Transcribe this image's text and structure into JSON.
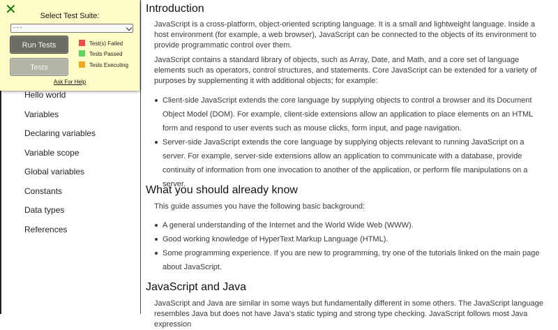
{
  "test_panel": {
    "title": "Select Test Suite:",
    "select_value": "- - -",
    "run_button": "Run Tests",
    "tests_button": "Tests",
    "legend": [
      {
        "label": "Test(s) Failed",
        "color": "#f04b4b"
      },
      {
        "label": "Tests Passed",
        "color": "#5cd65c"
      },
      {
        "label": "Tests Executing",
        "color": "#f5a623"
      }
    ],
    "help_link": "Ask For Help"
  },
  "sidebar": {
    "items": [
      {
        "label": "Hello world"
      },
      {
        "label": "Variables"
      },
      {
        "label": "Declaring variables"
      },
      {
        "label": "Variable scope"
      },
      {
        "label": "Global variables"
      },
      {
        "label": "Constants"
      },
      {
        "label": "Data types"
      },
      {
        "label": "References"
      }
    ]
  },
  "content": {
    "intro_heading": "Introduction",
    "intro_p1": "JavaScript is a cross-platform, object-oriented scripting language. It is a small and lightweight language. Inside a host environment (for example, a web browser), JavaScript can be connected to the objects of its environment to provide programmatic control over them.",
    "intro_p2": "JavaScript contains a standard library of objects, such as Array, Date, and Math, and a core set of language elements such as operators, control structures, and statements. Core JavaScript can be extended for a variety of purposes by supplementing it with additional objects; for example:",
    "intro_list": [
      "Client-side JavaScript extends the core language by supplying objects to control a browser and its Document Object Model (DOM). For example, client-side extensions allow an application to place elements on an HTML form and respond to user events such as mouse clicks, form input, and page navigation.",
      "Server-side JavaScript extends the core language by supplying objects relevant to running JavaScript on a server. For example, server-side extensions allow an application to communicate with a database, provide continuity of information from one invocation to another of the application, or perform file manipulations on a server."
    ],
    "know_heading": "What you should already know",
    "know_p": "This guide assumes you have the following basic background:",
    "know_list": [
      "A general understanding of the Internet and the World Wide Web (WWW).",
      "Good working knowledge of HyperText Markup Language (HTML).",
      "Some programming experience. If you are new to programming, try one of the tutorials linked on the main page about JavaScript."
    ],
    "java_heading": "JavaScript and Java",
    "java_p": "JavaScript and Java are similar in some ways but fundamentally different in some others. The JavaScript language resembles Java but does not have Java's static typing and strong type checking. JavaScript follows most Java expression"
  }
}
